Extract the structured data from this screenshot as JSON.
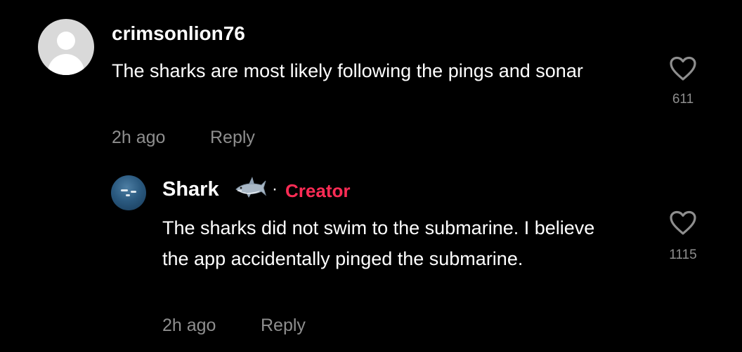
{
  "comment": {
    "username": "crimsonlion76",
    "text": "The sharks are most likely following the pings and sonar",
    "timestamp": "2h ago",
    "reply_label": "Reply",
    "like_count": "611",
    "avatar": "default-user-avatar"
  },
  "reply": {
    "username": "Shark",
    "username_emoji": "shark-icon",
    "separator": "·",
    "badge": "Creator",
    "text": "The sharks did not swim to the submarine. I believe the app accidentally pinged the submarine.",
    "timestamp": "2h ago",
    "reply_label": "Reply",
    "like_count": "1115",
    "avatar": "ocean-shark-avatar"
  },
  "colors": {
    "background": "#000000",
    "primary_text": "#ffffff",
    "secondary_text": "#8e8e8e",
    "creator_badge": "#fe2c55"
  },
  "icons": {
    "like": "heart-outline-icon"
  }
}
